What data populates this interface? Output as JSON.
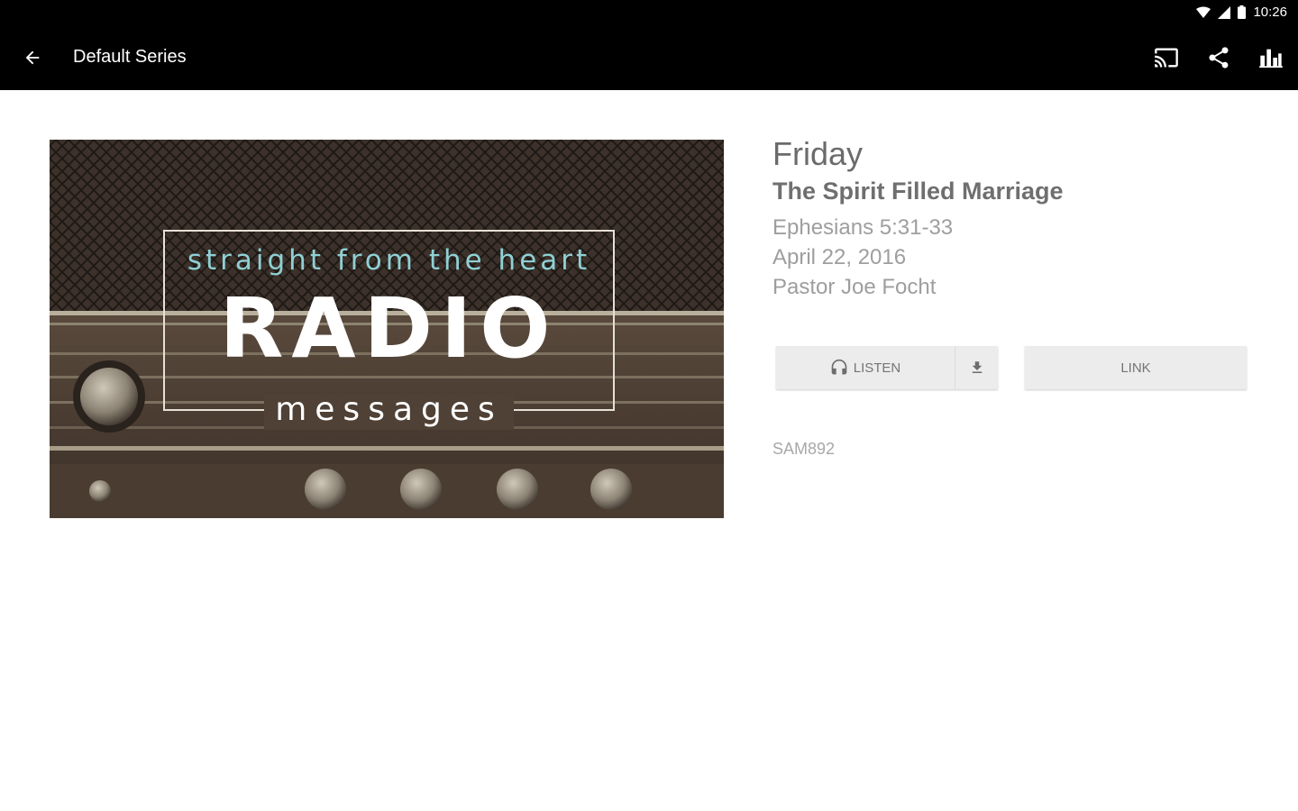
{
  "status": {
    "time": "10:26"
  },
  "app_bar": {
    "title": "Default Series"
  },
  "artwork": {
    "line1": "straight from the heart",
    "line2": "RADIO",
    "line3": "messages"
  },
  "message": {
    "day": "Friday",
    "title": "The Spirit Filled Marriage",
    "scripture": "Ephesians 5:31-33",
    "date": "April 22, 2016",
    "speaker": "Pastor Joe Focht",
    "code": "SAM892"
  },
  "buttons": {
    "listen": "LISTEN",
    "link": "LINK"
  },
  "icons": [
    "wifi-icon",
    "signal-icon",
    "battery-icon",
    "back-arrow-icon",
    "cast-icon",
    "share-icon",
    "bar-chart-icon",
    "headphones-icon",
    "download-icon"
  ]
}
